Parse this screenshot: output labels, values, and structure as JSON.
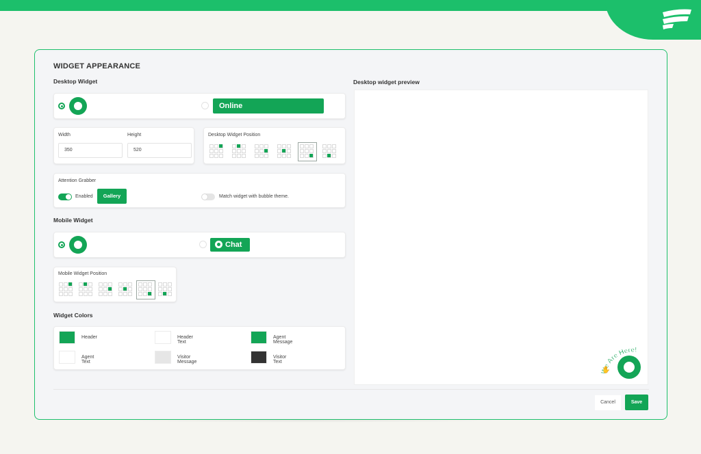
{
  "brand": {
    "color": "#1cbf6b",
    "icon": "brand-logo-icon"
  },
  "panel": {
    "title": "WIDGET APPEARANCE",
    "desktop_label": "Desktop Widget",
    "preview_label": "Desktop widget preview",
    "mobile_label": "Mobile Widget",
    "colors_label": "Widget Colors"
  },
  "desktop": {
    "online_label": "Online",
    "width_label": "Width",
    "width_value": "350",
    "height_label": "Height",
    "height_value": "520",
    "position_label": "Desktop Widget Position"
  },
  "attention": {
    "label": "Attention Grabber",
    "enabled_label": "Enabled",
    "gallery_label": "Gallery",
    "match_label": "Match widget with bubble theme."
  },
  "mobile": {
    "chat_label": "Chat",
    "position_label": "Mobile Widget Position"
  },
  "colors": {
    "items": [
      {
        "label": "Header",
        "color": "#13a556"
      },
      {
        "label": "Header Text",
        "color": "#ffffff"
      },
      {
        "label": "Agent Message",
        "color": "#13a556"
      },
      {
        "label": "Agent Text",
        "color": "#ffffff"
      },
      {
        "label": "Visitor Message",
        "color": "#e6e6e6"
      },
      {
        "label": "Visitor Text",
        "color": "#333333"
      }
    ]
  },
  "preview": {
    "badge_text": "We Are Here!",
    "badge_icon": "waving-hand-icon"
  },
  "footer": {
    "cancel_label": "Cancel",
    "save_label": "Save"
  }
}
